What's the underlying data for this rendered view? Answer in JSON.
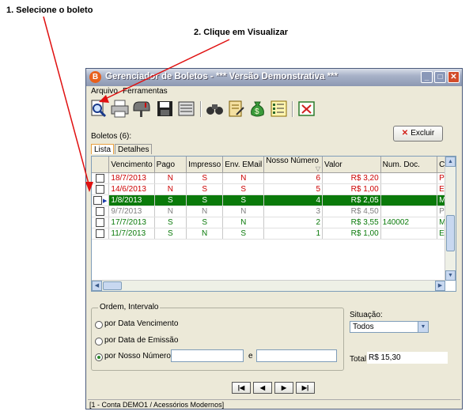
{
  "annotations": {
    "step1": "1. Selecione o boleto",
    "step2": "2. Clique em Visualizar"
  },
  "window": {
    "title": "Gerenciador de Boletos - *** Versão Demonstrativa ***",
    "app_icon": "B",
    "controls": {
      "minimize": "_",
      "maximize": "□",
      "close": "✕"
    }
  },
  "menu": {
    "items": [
      "Arquivo",
      "Ferramentas"
    ]
  },
  "toolbar": {
    "buttons": [
      "preview-icon",
      "printer-icon",
      "mailbox-icon",
      "save-disk-icon",
      "report-icon",
      "binoculars-icon",
      "document-edit-icon",
      "money-bag-icon",
      "list-icon",
      "close-window-icon"
    ]
  },
  "boletos_count_label": "Boletos (6):",
  "excluir_label": "Excluir",
  "tabs": [
    "Lista",
    "Detalhes"
  ],
  "table": {
    "columns": [
      "",
      "Vencimento",
      "Pago",
      "Impresso",
      "Env. EMail",
      "Nosso Número",
      "Valor",
      "Num. Doc.",
      "Clie"
    ],
    "rows": [
      {
        "vencimento": "18/7/2013",
        "pago": "N",
        "impresso": "S",
        "email": "N",
        "nosso_numero": "6",
        "valor": "R$ 3,20",
        "num_doc": "",
        "cliente": "Ped",
        "color": "#cc0000"
      },
      {
        "vencimento": "14/6/2013",
        "pago": "N",
        "impresso": "S",
        "email": "S",
        "nosso_numero": "5",
        "valor": "R$ 1,00",
        "num_doc": "",
        "cliente": "Eve",
        "color": "#cc0000"
      },
      {
        "vencimento": "1/8/2013",
        "pago": "S",
        "impresso": "S",
        "email": "S",
        "nosso_numero": "4",
        "valor": "R$ 2,05",
        "num_doc": "",
        "cliente": "Mar",
        "color": "#ffffff",
        "selected": true
      },
      {
        "vencimento": "9/7/2013",
        "pago": "N",
        "impresso": "N",
        "email": "N",
        "nosso_numero": "3",
        "valor": "R$ 4,50",
        "num_doc": "",
        "cliente": "Ped",
        "color": "#808080"
      },
      {
        "vencimento": "17/7/2013",
        "pago": "S",
        "impresso": "S",
        "email": "N",
        "nosso_numero": "2",
        "valor": "R$ 3,55",
        "num_doc": "140002",
        "cliente": "Mar",
        "color": "#0a7a0a"
      },
      {
        "vencimento": "11/7/2013",
        "pago": "S",
        "impresso": "N",
        "email": "S",
        "nosso_numero": "1",
        "valor": "R$ 1,00",
        "num_doc": "",
        "cliente": "Eve",
        "color": "#0a7a0a"
      }
    ]
  },
  "ordem": {
    "legend": "Ordem, Intervalo",
    "options": [
      "por Data Vencimento",
      "por Data de Emissão",
      "por Nosso Número"
    ],
    "selected_index": 2,
    "range_from": "",
    "range_sep": "e",
    "range_to": ""
  },
  "situacao": {
    "label": "Situação:",
    "value": "Todos"
  },
  "total": {
    "label": "Total:",
    "value": "R$ 15,30"
  },
  "nav": {
    "first": "|◀",
    "prev": "◀",
    "next": "▶",
    "last": "▶|"
  },
  "status_text": "[1 - Conta DEMO1 / Acessórios Modernos]"
}
